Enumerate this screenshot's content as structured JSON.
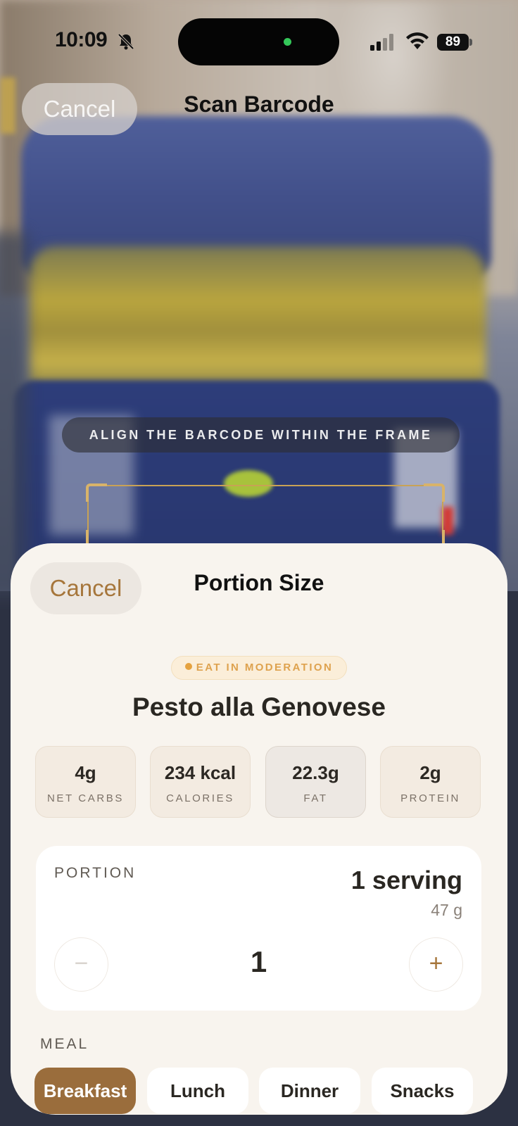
{
  "status_bar": {
    "time": "10:09",
    "battery": "89",
    "icons": [
      "bell-slash-icon",
      "signal-icon",
      "wifi-icon",
      "battery-icon"
    ]
  },
  "camera": {
    "cancel_label": "Cancel",
    "title": "Scan Barcode",
    "instruction": "ALIGN THE BARCODE WITHIN THE FRAME",
    "frame_color": "#c8a255"
  },
  "sheet": {
    "cancel_label": "Cancel",
    "title": "Portion Size",
    "badge": "EAT IN MODERATION",
    "badge_color": "#e5a23f",
    "food_name": "Pesto alla Genovese",
    "stats": [
      {
        "value": "4g",
        "label": "NET CARBS"
      },
      {
        "value": "234 kcal",
        "label": "CALORIES"
      },
      {
        "value": "22.3g",
        "label": "FAT"
      },
      {
        "value": "2g",
        "label": "PROTEIN"
      }
    ],
    "portion": {
      "label": "PORTION",
      "serving": "1 serving",
      "grams": "47 g",
      "quantity": "1",
      "minus": "−",
      "plus": "+"
    },
    "meal": {
      "label": "MEAL",
      "options": [
        "Breakfast",
        "Lunch",
        "Dinner",
        "Snacks"
      ],
      "selected": "Breakfast"
    },
    "accent_color": "#9a6d3c"
  }
}
